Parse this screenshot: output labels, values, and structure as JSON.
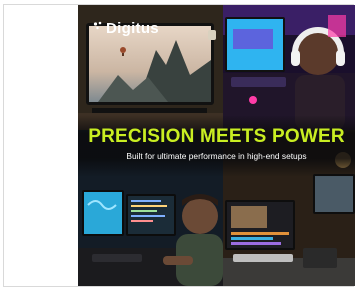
{
  "brand": {
    "name": "Digitus"
  },
  "hero": {
    "headline": "PRECISION MEETS POWER",
    "subline": "Built for ultimate performance in high-end setups"
  },
  "colors": {
    "accent": "#c9ee22",
    "banner_bg": "#101318"
  },
  "icons": {
    "logo": "digitus-logo-icon"
  }
}
